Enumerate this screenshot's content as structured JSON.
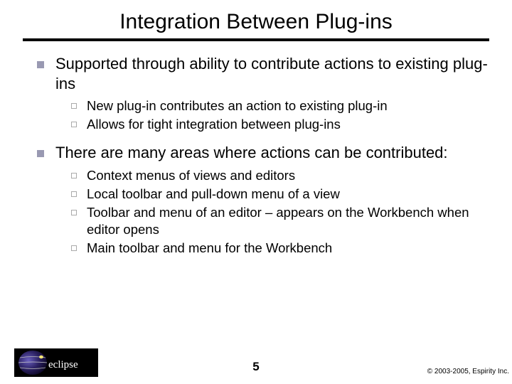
{
  "title": "Integration Between Plug-ins",
  "bullets": [
    {
      "text": "Supported through ability to contribute actions to existing plug-ins",
      "sub": [
        "New plug-in contributes an action to existing plug-in",
        "Allows for tight integration between plug-ins"
      ]
    },
    {
      "text": "There are many areas where actions can be contributed:",
      "sub": [
        "Context menus of views and editors",
        "Local toolbar and pull-down menu of a view",
        "Toolbar and menu of an editor – appears on the Workbench when editor opens",
        "Main toolbar and menu for the Workbench"
      ]
    }
  ],
  "page_number": "5",
  "copyright": "© 2003-2005, Espirity Inc.",
  "logo_text": "eclipse"
}
